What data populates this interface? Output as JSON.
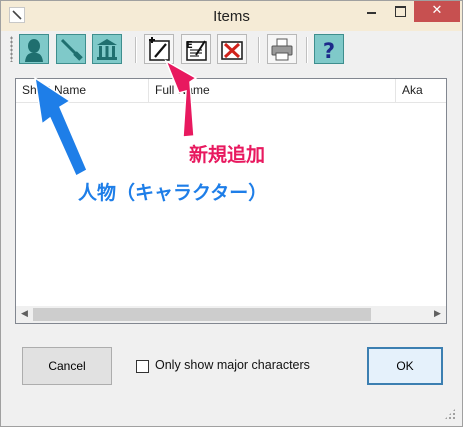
{
  "window": {
    "title": "Items",
    "close_glyph": "✕"
  },
  "toolbar": {
    "buttons": [
      {
        "name": "person-button",
        "icon": "person-icon"
      },
      {
        "name": "item-button",
        "icon": "knife-icon"
      },
      {
        "name": "place-button",
        "icon": "building-icon"
      },
      {
        "name": "add-button",
        "icon": "add-new-icon"
      },
      {
        "name": "edit-button",
        "icon": "edit-icon"
      },
      {
        "name": "delete-button",
        "icon": "delete-icon"
      },
      {
        "name": "print-button",
        "icon": "printer-icon"
      },
      {
        "name": "help-button",
        "icon": "help-icon",
        "label": "?"
      }
    ]
  },
  "list": {
    "columns": [
      "Short Name",
      "Full Name",
      "Aka"
    ],
    "rows": []
  },
  "controls": {
    "cancel_label": "Cancel",
    "checkbox_label": "Only show major characters",
    "checkbox_checked": false,
    "ok_label": "OK"
  },
  "annotations": {
    "add_new": {
      "text": "新規追加",
      "color": "#e8195f"
    },
    "character": {
      "text": "人物（キャラクター）",
      "color": "#1e7ee8"
    }
  },
  "colors": {
    "toolbar_teal": "#7fc9c9",
    "close_red": "#c75050",
    "titlebar": "#f5ebd6",
    "ok_border": "#3c7fb1"
  }
}
